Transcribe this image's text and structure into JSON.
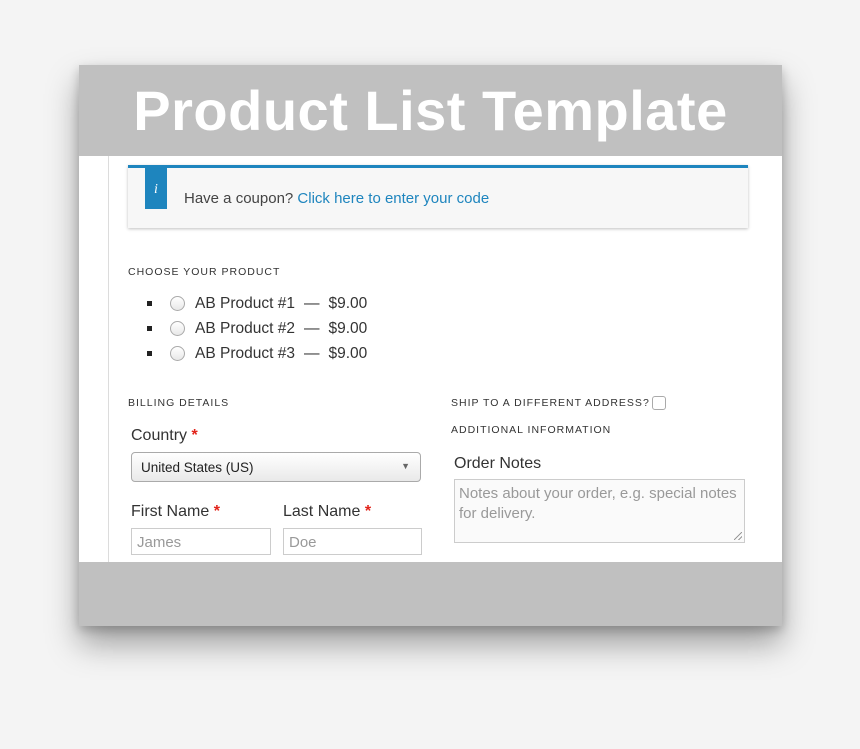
{
  "banner": {
    "title": "Product List Template"
  },
  "coupon": {
    "icon": "i",
    "text": "Have a coupon? ",
    "link": "Click here to enter your code"
  },
  "product_section": {
    "label": "CHOOSE YOUR PRODUCT",
    "items": [
      {
        "name": "AB Product #1",
        "dash": "—",
        "price": "$9.00"
      },
      {
        "name": "AB Product #2",
        "dash": "—",
        "price": "$9.00"
      },
      {
        "name": "AB Product #3",
        "dash": "—",
        "price": "$9.00"
      }
    ]
  },
  "billing": {
    "label": "BILLING DETAILS",
    "country_label": "Country",
    "required_mark": "*",
    "country_value": "United States (US)",
    "first_name_label": "First Name",
    "first_name_value": "James",
    "last_name_label": "Last Name",
    "last_name_value": "Doe"
  },
  "shipping": {
    "ship_label": "SHIP TO A DIFFERENT ADDRESS?",
    "additional_label": "ADDITIONAL INFORMATION",
    "order_notes_label": "Order Notes",
    "order_notes_placeholder": "Notes about your order, e.g. special notes for delivery."
  },
  "colors": {
    "accent": "#1e85be",
    "required": "#e2231a",
    "banner": "#c0c0c0"
  }
}
